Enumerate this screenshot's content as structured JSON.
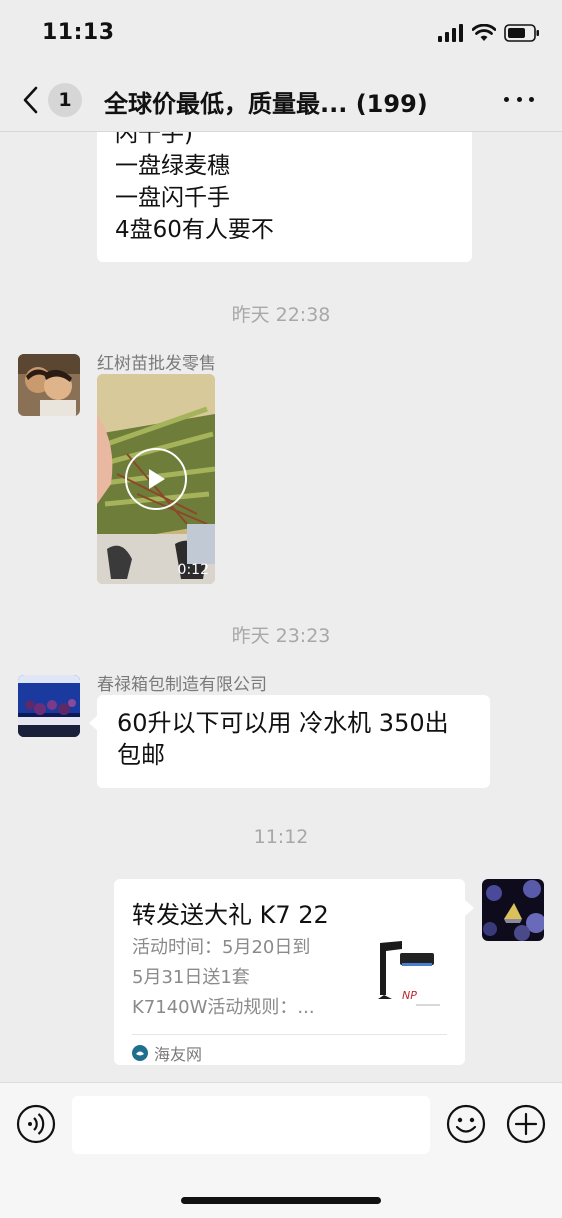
{
  "status": {
    "time": "11:13"
  },
  "nav": {
    "unread_count": "1",
    "title": "全球价最低，质量最... (199)"
  },
  "messages": {
    "top_bubble_lines": [
      "闪千手)",
      "一盘绿麦穗",
      "一盘闪千手",
      "4盘60有人要不"
    ],
    "timestamp_1": "昨天 22:38",
    "sender_1": "红树苗批发零售",
    "video_duration": "0:12",
    "timestamp_2": "昨天 23:23",
    "sender_2": "春禄箱包制造有限公司",
    "message_2": "60升以下可以用 冷水机 350出包邮",
    "timestamp_3": "11:12",
    "link_card": {
      "title": "转发送大礼 K7 22",
      "desc_lines": [
        "活动时间：5月20日到",
        "5月31日送1套",
        "K7140W活动规则：..."
      ],
      "thumb_brand": "NP",
      "source": "海友网"
    }
  },
  "input": {
    "placeholder": ""
  },
  "icons": {
    "back": "chevron-left-icon",
    "mute": "bell-off-icon",
    "more": "more-dots-icon",
    "voice": "voice-icon",
    "emoji": "emoji-icon",
    "plus": "plus-icon",
    "play": "play-icon"
  },
  "colors": {
    "background": "#ededed",
    "bubble": "#ffffff",
    "timestamp": "#a8a8a8"
  }
}
